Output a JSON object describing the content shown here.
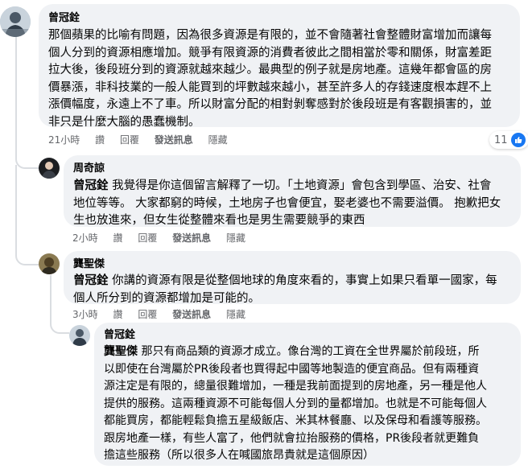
{
  "actions": {
    "like": "讚",
    "reply": "回覆",
    "send_message": "發送訊息",
    "hide": "隱藏"
  },
  "comments": [
    {
      "author": "曾冠銓",
      "body": "那個蘋果的比喻有問題，因為很多資源是有限的，並不會隨著社會整體財富增加而讓每\n個人分到的資源相應增加。競爭有限資源的消費者彼此之間相當於零和關係，財富差距\n拉大後，後段班分到的資源就越來越少。最典型的例子就是房地產。這幾年都會區的房\n價暴漲，非科技業的一般人能買到的坪數越來越小，甚至許多人的存錢速度根本趕不上\n漲價幅度，永遠上不了車。所以財富分配的相對剝奪感對於後段班是有客觀損害的，並\n非只是什麼大腦的愚蠢機制。",
      "time": "21小時",
      "reaction_count": "11"
    },
    {
      "author": "周奇諒",
      "mention": "曾冠銓",
      "body": " 我覺得是你這個留言解釋了一切。「土地資源」會包含到學區、治安、社會\n地位等等。 大家都窮的時候，土地房子也會便宜，娶老婆也不需要溢價。 抱歉把女\n生也放進來，但女生從整體來看也是男生需要競爭的東西",
      "time": "2小時"
    },
    {
      "author": "龔聖傑",
      "mention": "曾冠銓",
      "body": " 你講的資源有限是從整個地球的角度來看的，事實上如果只看單一國家，每\n個人所分到的資源都增加是可能的。",
      "time": "3小時"
    },
    {
      "author": "曾冠銓",
      "mention": "龔聖傑",
      "body": " 那只有商品類的資源才成立。像台灣的工資在全世界屬於前段班，所\n以即使在台灣屬於PR後段者也買得起中國等地製造的便宜商品。但有兩種資\n源注定是有限的，總量很難增加，一種是我前面提到的房地產，另一種是他人\n提供的服務。這兩種資源不可能每個人分到的量都增加。也就是不可能每個人\n都能買房，都能輕鬆負擔五星級飯店、米其林餐廳、以及保母和看護等服務。\n跟房地產一樣，有些人富了，他們就會拉抬服務的價格，PR後段者就更難負\n擔這些服務（所以很多人在喊國旅昂貴就是這個原因）"
    }
  ],
  "colors": {
    "bubble_bg": "#f0f2f5",
    "meta_text": "#65676b",
    "like_blue": "#1877f2",
    "thread_line": "#dadde1"
  },
  "icons": {
    "reaction": "like-icon",
    "avatar_1": "profile-photo",
    "avatar_2": "profile-photo",
    "avatar_3": "profile-photo"
  }
}
